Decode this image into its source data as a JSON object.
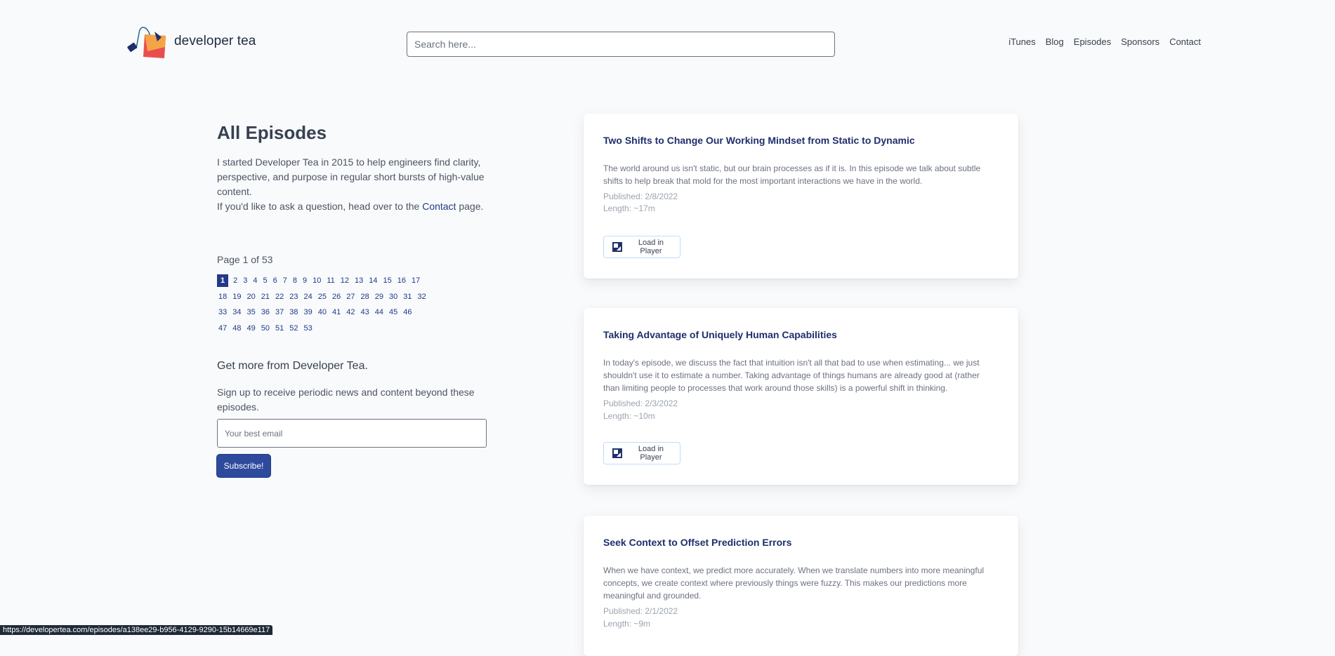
{
  "header": {
    "brand": "developer tea",
    "search_placeholder": "Search here...",
    "nav": [
      "iTunes",
      "Blog",
      "Episodes",
      "Sponsors",
      "Contact"
    ]
  },
  "intro": {
    "title": "All Episodes",
    "text1": "I started Developer Tea in 2015 to help engineers find clarity, perspective, and purpose in regular short bursts of high-value content.",
    "text2_before": "If you'd like to ask a question, head over to the ",
    "text2_link": "Contact",
    "text2_after": " page."
  },
  "pagination": {
    "info": "Page 1 of 53",
    "current": 1,
    "rows": [
      [
        "1",
        "2",
        "3",
        "4",
        "5",
        "6",
        "7",
        "8",
        "9",
        "10",
        "11",
        "12",
        "13",
        "14",
        "15",
        "16",
        "17"
      ],
      [
        "18",
        "19",
        "20",
        "21",
        "22",
        "23",
        "24",
        "25",
        "26",
        "27",
        "28",
        "29",
        "30",
        "31",
        "32"
      ],
      [
        "33",
        "34",
        "35",
        "36",
        "37",
        "38",
        "39",
        "40",
        "41",
        "42",
        "43",
        "44",
        "45",
        "46"
      ],
      [
        "47",
        "48",
        "49",
        "50",
        "51",
        "52",
        "53"
      ]
    ]
  },
  "signup": {
    "heading": "Get more from Developer Tea.",
    "text": "Sign up to receive periodic news and content beyond these episodes.",
    "email_placeholder": "Your best email",
    "button": "Subscribe!"
  },
  "episodes": [
    {
      "title": "Two Shifts to Change Our Working Mindset from Static to Dynamic",
      "description": "The world around us isn't static, but our brain processes as if it is. In this episode we talk about subtle shifts to help break that mold for the most important interactions we have in the world.",
      "published": "Published: 2/8/2022",
      "length": "Length: ~17m",
      "button": "Load in Player"
    },
    {
      "title": "Taking Advantage of Uniquely Human Capabilities",
      "description": "In today's episode, we discuss the fact that intuition isn't all that bad to use when estimating... we just shouldn't use it to estimate a number. Taking advantage of things humans are already good at (rather than limiting people to processes that work around those skills) is a powerful shift in thinking.",
      "published": "Published: 2/3/2022",
      "length": "Length: ~10m",
      "button": "Load in Player"
    },
    {
      "title": "Seek Context to Offset Prediction Errors",
      "description": "When we have context, we predict more accurately. When we translate numbers into more meaningful concepts, we create context where previously things were fuzzy. This makes our predictions more meaningful and grounded.",
      "published": "Published: 2/1/2022",
      "length": "Length: ~9m"
    }
  ],
  "status_url": "https://developertea.com/episodes/a138ee29-b956-4129-9290-15b14669e117"
}
